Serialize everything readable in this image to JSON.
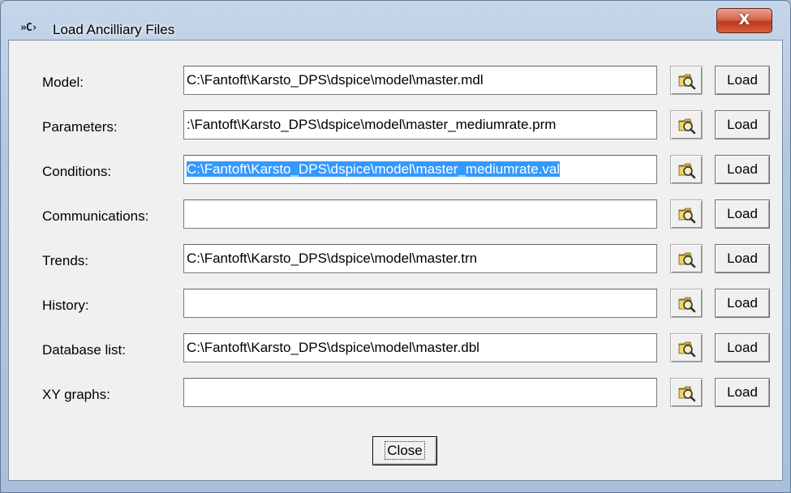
{
  "window": {
    "title": "Load Ancilliary Files",
    "app_icon_glyph": "»C›",
    "close_glyph": "X"
  },
  "rows": [
    {
      "label": "Model:",
      "value": "C:\\Fantoft\\Karsto_DPS\\dspice\\model\\master.mdl",
      "selected": false,
      "load_label": "Load"
    },
    {
      "label": "Parameters:",
      "value": ":\\Fantoft\\Karsto_DPS\\dspice\\model\\master_mediumrate.prm",
      "selected": false,
      "load_label": "Load"
    },
    {
      "label": "Conditions:",
      "value": "C:\\Fantoft\\Karsto_DPS\\dspice\\model\\master_mediumrate.val",
      "selected": true,
      "load_label": "Load"
    },
    {
      "label": "Communications:",
      "value": "",
      "selected": false,
      "load_label": "Load"
    },
    {
      "label": "Trends:",
      "value": "C:\\Fantoft\\Karsto_DPS\\dspice\\model\\master.trn",
      "selected": false,
      "load_label": "Load"
    },
    {
      "label": "History:",
      "value": "",
      "selected": false,
      "load_label": "Load"
    },
    {
      "label": "Database list:",
      "value": "C:\\Fantoft\\Karsto_DPS\\dspice\\model\\master.dbl",
      "selected": false,
      "load_label": "Load"
    },
    {
      "label": "XY graphs:",
      "value": "",
      "selected": false,
      "load_label": "Load"
    }
  ],
  "browse_icon": "folder-magnifier-icon",
  "footer": {
    "close_label": "Close"
  },
  "colors": {
    "selection": "#3399ff",
    "dialog_bg": "#f0f0f0",
    "close_button_red": "#c0391e"
  }
}
